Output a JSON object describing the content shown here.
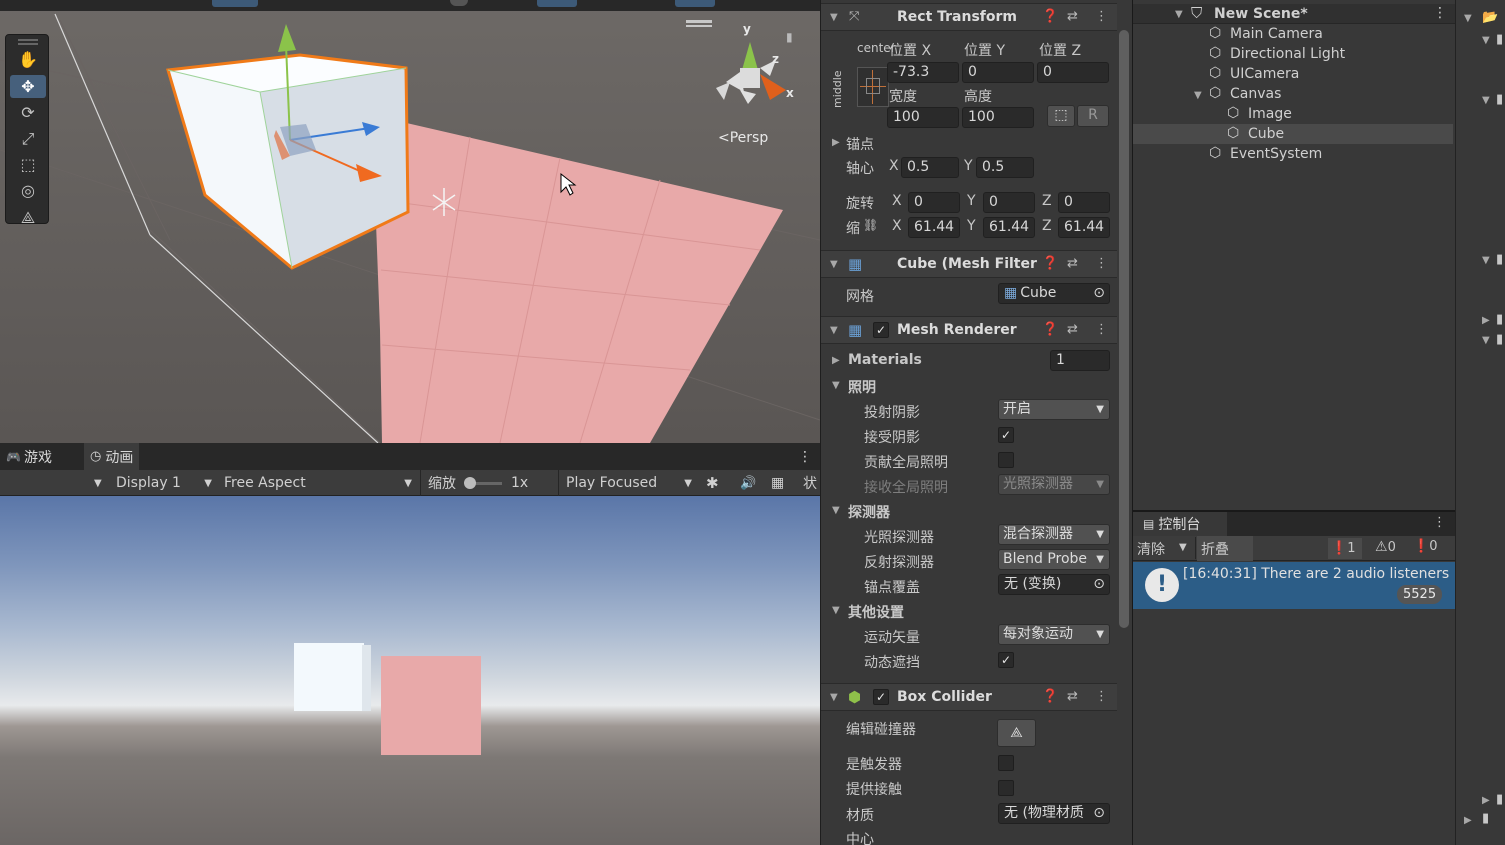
{
  "scene": {
    "persp_label": "Persp",
    "gizmo": {
      "y": "y",
      "x": "x",
      "z": "z"
    }
  },
  "tools": [
    "hand-icon",
    "move-icon",
    "rotate-icon",
    "scale-icon",
    "rect-icon",
    "transform-icon",
    "custom-tool-icon"
  ],
  "game_tabs": {
    "game": "游戏",
    "animation": "动画"
  },
  "game_bar": {
    "display": "Display 1",
    "aspect": "Free Aspect",
    "scale_label": "缩放",
    "scale_value": "1x",
    "play_mode": "Play Focused",
    "stats": "状"
  },
  "inspector": {
    "rect_transform": {
      "title": "Rect Transform",
      "anchor_h": "center",
      "anchor_v": "middle",
      "pos_x_label": "位置 X",
      "pos_y_label": "位置 Y",
      "pos_z_label": "位置 Z",
      "pos_x": "-73.3",
      "pos_y": "0",
      "pos_z": "0",
      "width_label": "宽度",
      "height_label": "高度",
      "width": "100",
      "height": "100",
      "r_button": "R",
      "anchors_label": "锚点",
      "pivot_label": "轴心",
      "pivot_x": "0.5",
      "pivot_y": "0.5",
      "rotation_label": "旋转",
      "rot_x": "0",
      "rot_y": "0",
      "rot_z": "0",
      "scale_label": "缩",
      "scale_x": "61.44",
      "scale_y": "61.44",
      "scale_z": "61.44",
      "x": "X",
      "y": "Y",
      "z": "Z"
    },
    "mesh_filter": {
      "title": "Cube (Mesh Filter",
      "mesh_label": "网格",
      "mesh_value": "Cube"
    },
    "mesh_renderer": {
      "title": "Mesh Renderer",
      "materials_label": "Materials",
      "materials_count": "1",
      "lighting_label": "照明",
      "cast_shadows_label": "投射阴影",
      "cast_shadows_value": "开启",
      "receive_shadows_label": "接受阴影",
      "contribute_gi_label": "贡献全局照明",
      "receive_gi_label": "接收全局照明",
      "receive_gi_value": "光照探测器",
      "probes_label": "探测器",
      "light_probes_label": "光照探测器",
      "light_probes_value": "混合探测器",
      "reflection_probes_label": "反射探测器",
      "reflection_probes_value": "Blend Probe",
      "anchor_override_label": "锚点覆盖",
      "anchor_override_value": "无 (变换)",
      "additional_label": "其他设置",
      "motion_vectors_label": "运动矢量",
      "motion_vectors_value": "每对象运动",
      "dynamic_occlusion_label": "动态遮挡"
    },
    "box_collider": {
      "title": "Box Collider",
      "edit_label": "编辑碰撞器",
      "is_trigger_label": "是触发器",
      "provides_contacts_label": "提供接触",
      "material_label": "材质",
      "material_value": "无 (物理材质",
      "center_label": "中心"
    }
  },
  "hierarchy": {
    "scene_name": "New Scene*",
    "items": [
      "Main Camera",
      "Directional Light",
      "UICamera",
      "Canvas",
      "Image",
      "Cube",
      "EventSystem"
    ]
  },
  "console": {
    "tab": "控制台",
    "clear": "清除",
    "collapse": "折叠",
    "count_info": "1",
    "count_warn": "0",
    "count_error": "0",
    "message": "[16:40:31] There are 2 audio listeners",
    "message_count": "5525"
  },
  "colors": {
    "accent": "#46607c",
    "selected_row": "#4a4a4a",
    "console_row": "#2c5d87",
    "pink": "#e6a6a6"
  }
}
